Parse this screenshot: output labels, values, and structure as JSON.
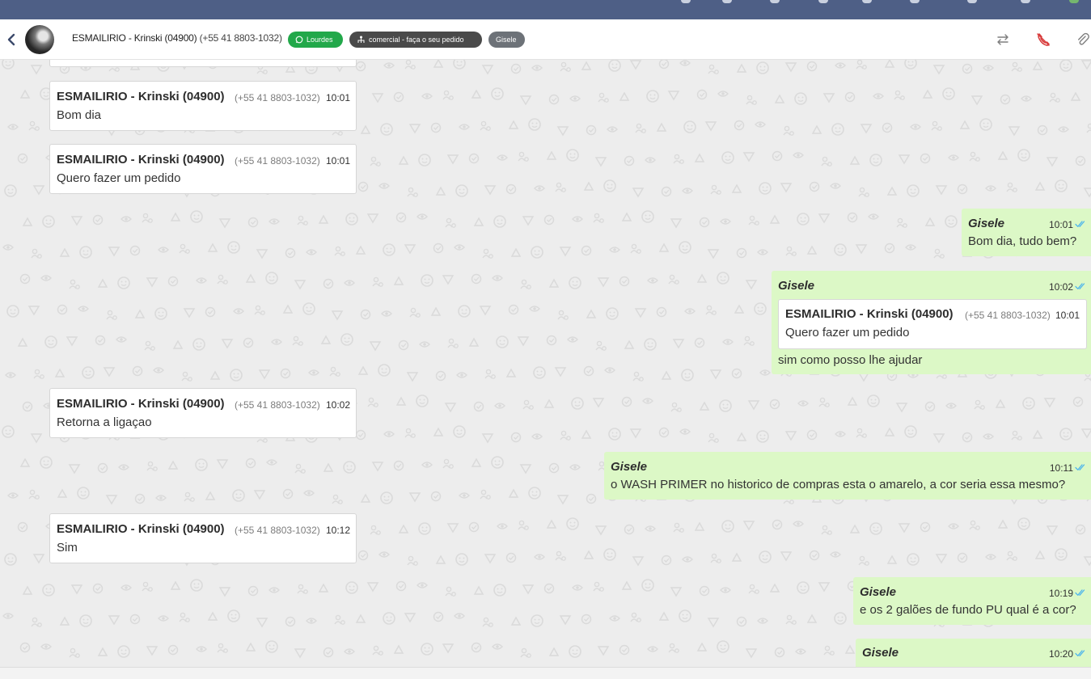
{
  "header": {
    "contact_name": "ESMAILIRIO - Krinski (04900)",
    "contact_phone": "(+55 41 8803-1032)",
    "connection_badge": "Lourdes",
    "queue_badge": "comercial - faça o seu pedido",
    "user_badge": "Gisele"
  },
  "colors": {
    "topbar": "#4e5f86",
    "badge_connection": "#22a84a",
    "badge_queue": "#4a4a4a",
    "badge_user": "#6d7278",
    "outgoing_bubble": "#dcf8c6",
    "incoming_bubble": "#ffffff",
    "read_ticks": "#4fb6ec",
    "hangup_icon": "#d83b3b"
  },
  "icons": [
    "back-icon",
    "whatsapp-icon",
    "queue-icon",
    "transfer-icon",
    "hangup-call-icon",
    "attachment-icon",
    "read-ticks-icon"
  ],
  "messages": [
    {
      "type": "in",
      "author": "ESMAILIRIO - Krinski (04900)",
      "phone": "(+55 41 8803-1032)",
      "time": "10:01",
      "text": "Bom dia"
    },
    {
      "type": "in",
      "author": "ESMAILIRIO - Krinski (04900)",
      "phone": "(+55 41 8803-1032)",
      "time": "10:01",
      "text": "Quero fazer um pedido"
    },
    {
      "type": "out",
      "author": "Gisele",
      "time": "10:01",
      "text": "Bom dia, tudo bem?"
    },
    {
      "type": "out",
      "author": "Gisele",
      "time": "10:02",
      "text": "sim como posso lhe ajudar",
      "quoted": {
        "author": "ESMAILIRIO - Krinski (04900)",
        "phone": "(+55 41 8803-1032)",
        "time": "10:01",
        "text": "Quero fazer um pedido"
      }
    },
    {
      "type": "in",
      "author": "ESMAILIRIO - Krinski (04900)",
      "phone": "(+55 41 8803-1032)",
      "time": "10:02",
      "text": "Retorna a ligaçao"
    },
    {
      "type": "out",
      "author": "Gisele",
      "time": "10:11",
      "text": "o WASH PRIMER no historico de compras esta o amarelo, a cor seria essa mesmo?"
    },
    {
      "type": "in",
      "author": "ESMAILIRIO - Krinski (04900)",
      "phone": "(+55 41 8803-1032)",
      "time": "10:12",
      "text": "Sim"
    },
    {
      "type": "out",
      "author": "Gisele",
      "time": "10:19",
      "text": "e os 2 galões de fundo PU qual é a cor?"
    },
    {
      "type": "out",
      "author": "Gisele",
      "time": "10:20",
      "text": ""
    }
  ]
}
